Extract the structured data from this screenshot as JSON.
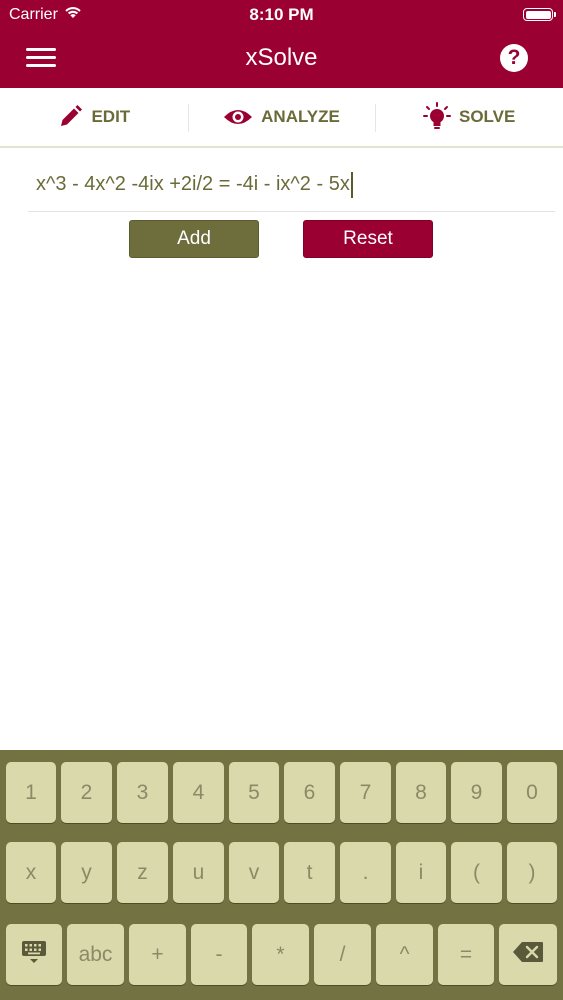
{
  "status_bar": {
    "carrier": "Carrier",
    "time": "8:10 PM"
  },
  "nav": {
    "title": "xSolve"
  },
  "tabs": [
    {
      "label": "EDIT",
      "icon": "pencil-icon",
      "active": true
    },
    {
      "label": "ANALYZE",
      "icon": "eye-icon",
      "active": false
    },
    {
      "label": "SOLVE",
      "icon": "lightbulb-icon",
      "active": false
    }
  ],
  "editor": {
    "equation": "x^3 - 4x^2 -4ix +2i/2 = -4i - ix^2 - 5x"
  },
  "buttons": {
    "add": "Add",
    "reset": "Reset"
  },
  "keyboard": {
    "row1": [
      "1",
      "2",
      "3",
      "4",
      "5",
      "6",
      "7",
      "8",
      "9",
      "0"
    ],
    "row2": [
      "x",
      "y",
      "z",
      "u",
      "v",
      "t",
      ".",
      "i",
      "(",
      ")"
    ],
    "row3": [
      "abc",
      "+",
      "-",
      "*",
      "/",
      "^",
      "="
    ],
    "icons": {
      "keyboard_toggle": "keyboard-icon",
      "delete": "backspace-icon"
    }
  },
  "colors": {
    "brand": "#9b0033",
    "olive": "#6e6e3d",
    "key": "#d9d9ab",
    "keyboard_bg": "#727242"
  }
}
